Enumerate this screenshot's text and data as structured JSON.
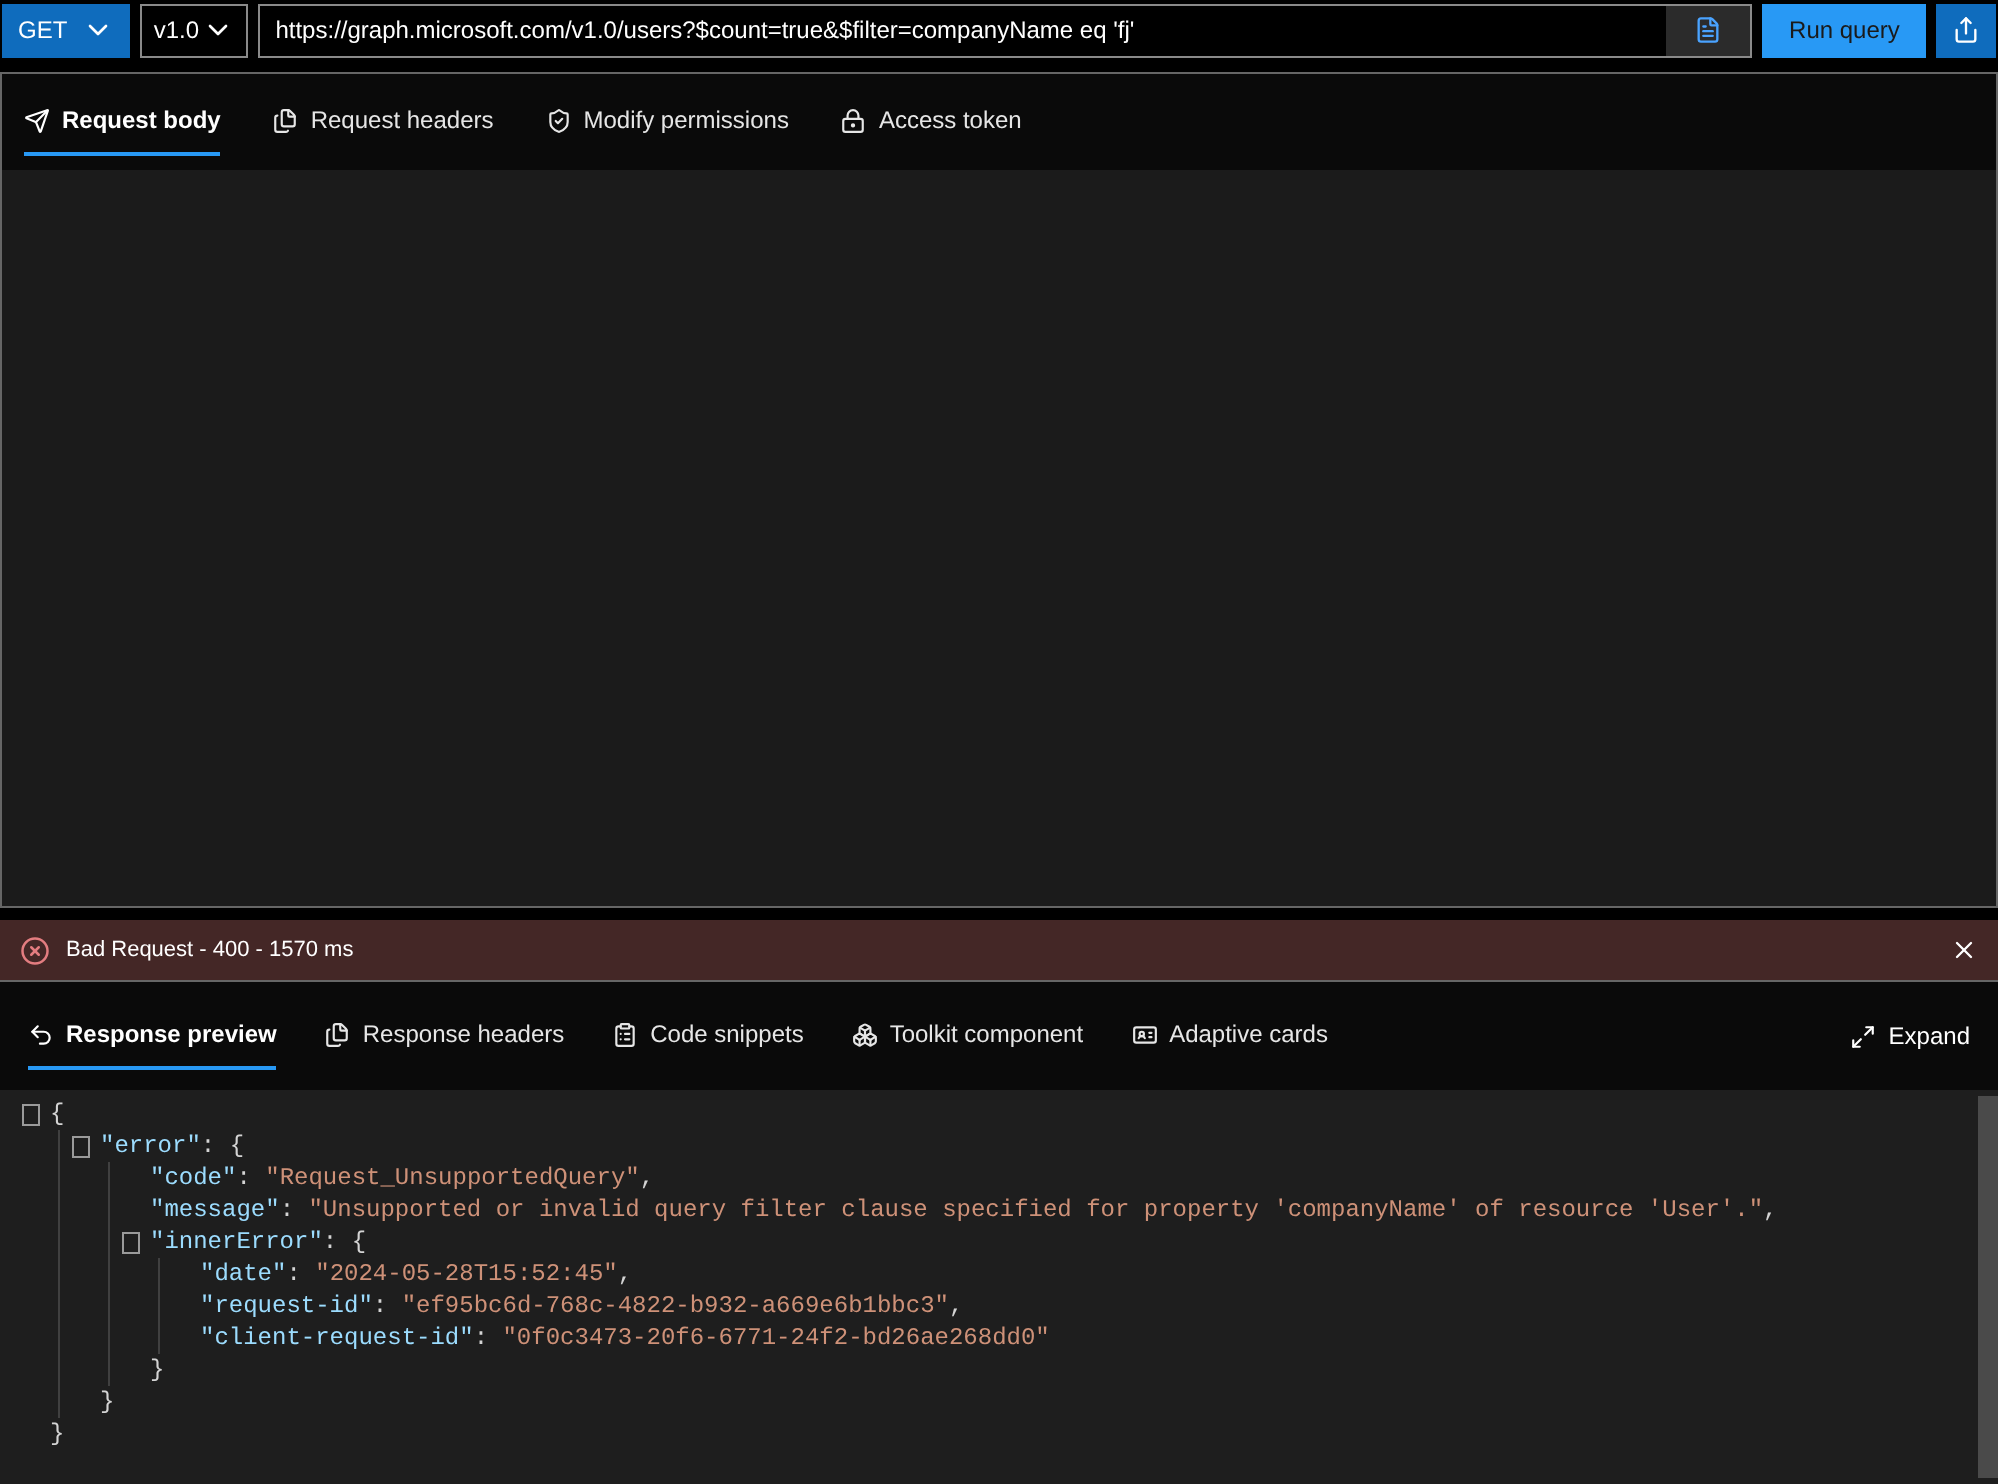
{
  "query_bar": {
    "method": "GET",
    "version": "v1.0",
    "url": "https://graph.microsoft.com/v1.0/users?$count=true&$filter=companyName eq 'fj'",
    "run_button": "Run query"
  },
  "request_tabs": [
    {
      "label": "Request body",
      "selected": true
    },
    {
      "label": "Request headers",
      "selected": false
    },
    {
      "label": "Modify permissions",
      "selected": false
    },
    {
      "label": "Access token",
      "selected": false
    }
  ],
  "status": {
    "text": "Bad Request - 400 - 1570 ms",
    "kind": "error"
  },
  "response_tabs": [
    {
      "label": "Response preview",
      "selected": true
    },
    {
      "label": "Response headers",
      "selected": false
    },
    {
      "label": "Code snippets",
      "selected": false
    },
    {
      "label": "Toolkit component",
      "selected": false
    },
    {
      "label": "Adaptive cards",
      "selected": false
    }
  ],
  "expand_button": "Expand",
  "response": {
    "foldable": true,
    "tokens": [
      {
        "kind": "punct",
        "text": "{"
      }
    ],
    "close": "}",
    "children": [
      {
        "foldable": true,
        "tokens": [
          {
            "kind": "key",
            "text": "\"error\""
          },
          {
            "kind": "punct",
            "text": ": {"
          }
        ],
        "close": "}",
        "children": [
          {
            "foldable": false,
            "tokens": [
              {
                "kind": "key",
                "text": "\"code\""
              },
              {
                "kind": "punct",
                "text": ": "
              },
              {
                "kind": "string",
                "text": "\"Request_UnsupportedQuery\""
              },
              {
                "kind": "punct",
                "text": ","
              }
            ]
          },
          {
            "foldable": false,
            "tokens": [
              {
                "kind": "key",
                "text": "\"message\""
              },
              {
                "kind": "punct",
                "text": ": "
              },
              {
                "kind": "string",
                "text": "\"Unsupported or invalid query filter clause specified for property 'companyName' of resource 'User'.\""
              },
              {
                "kind": "punct",
                "text": ","
              }
            ]
          },
          {
            "foldable": true,
            "tokens": [
              {
                "kind": "key",
                "text": "\"innerError\""
              },
              {
                "kind": "punct",
                "text": ": {"
              }
            ],
            "close": "}",
            "children": [
              {
                "foldable": false,
                "tokens": [
                  {
                    "kind": "key",
                    "text": "\"date\""
                  },
                  {
                    "kind": "punct",
                    "text": ": "
                  },
                  {
                    "kind": "string",
                    "text": "\"2024-05-28T15:52:45\""
                  },
                  {
                    "kind": "punct",
                    "text": ","
                  }
                ]
              },
              {
                "foldable": false,
                "tokens": [
                  {
                    "kind": "key",
                    "text": "\"request-id\""
                  },
                  {
                    "kind": "punct",
                    "text": ": "
                  },
                  {
                    "kind": "string",
                    "text": "\"ef95bc6d-768c-4822-b932-a669e6b1bbc3\""
                  },
                  {
                    "kind": "punct",
                    "text": ","
                  }
                ]
              },
              {
                "foldable": false,
                "tokens": [
                  {
                    "kind": "key",
                    "text": "\"client-request-id\""
                  },
                  {
                    "kind": "punct",
                    "text": ": "
                  },
                  {
                    "kind": "string",
                    "text": "\"0f0c3473-20f6-6771-24f2-bd26ae268dd0\""
                  }
                ]
              }
            ]
          }
        ]
      }
    ]
  }
}
